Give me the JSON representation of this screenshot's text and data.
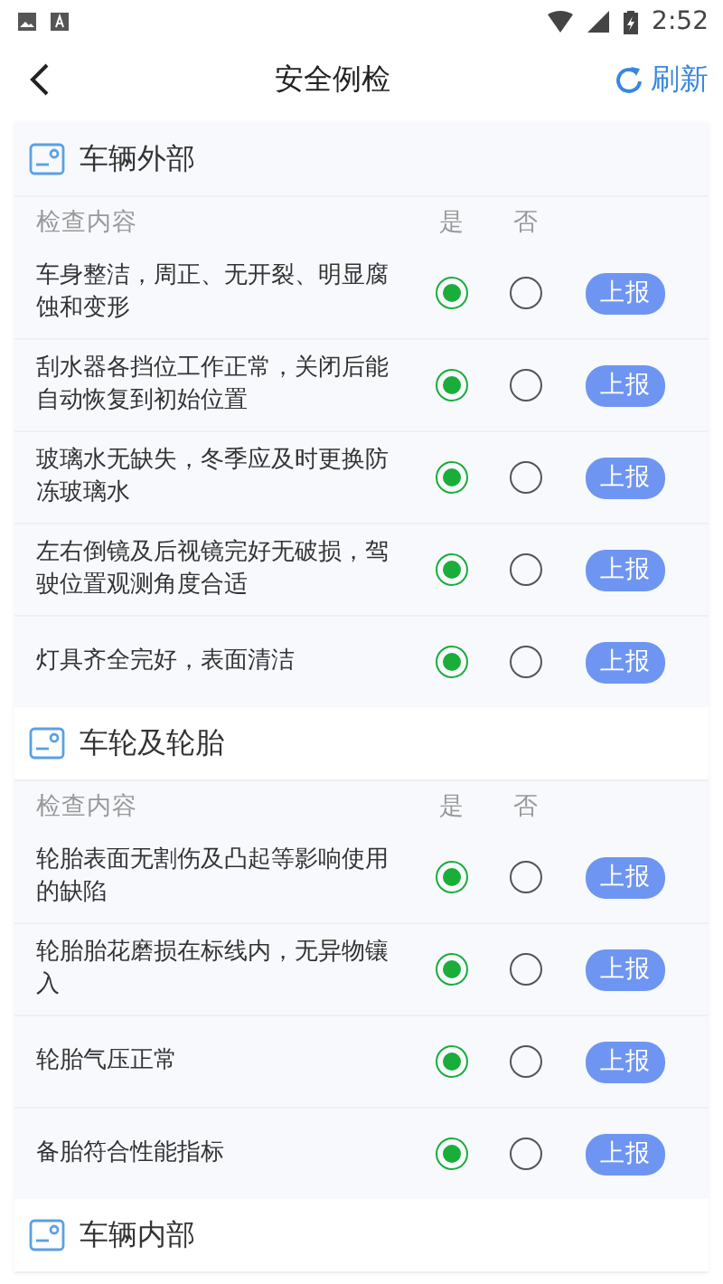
{
  "status_bar": {
    "time": "2:52"
  },
  "header": {
    "title": "安全例检",
    "refresh": "刷新"
  },
  "sections": [
    {
      "title": "车辆外部",
      "columns": {
        "content": "检查内容",
        "yes": "是",
        "no": "否"
      },
      "items": [
        {
          "text": "车身整洁，周正、无开裂、明显腐蚀和变形",
          "yes_selected": true,
          "no_selected": false,
          "report": "上报"
        },
        {
          "text": "刮水器各挡位工作正常，关闭后能自动恢复到初始位置",
          "yes_selected": true,
          "no_selected": false,
          "report": "上报"
        },
        {
          "text": "玻璃水无缺失，冬季应及时更换防冻玻璃水",
          "yes_selected": true,
          "no_selected": false,
          "report": "上报"
        },
        {
          "text": "左右倒镜及后视镜完好无破损，驾驶位置观测角度合适",
          "yes_selected": true,
          "no_selected": false,
          "report": "上报"
        },
        {
          "text": "灯具齐全完好，表面清洁",
          "yes_selected": true,
          "no_selected": false,
          "report": "上报"
        }
      ]
    },
    {
      "title": "车轮及轮胎",
      "columns": {
        "content": "检查内容",
        "yes": "是",
        "no": "否"
      },
      "items": [
        {
          "text": "轮胎表面无割伤及凸起等影响使用的缺陷",
          "yes_selected": true,
          "no_selected": false,
          "report": "上报"
        },
        {
          "text": "轮胎胎花磨损在标线内，无异物镶入",
          "yes_selected": true,
          "no_selected": false,
          "report": "上报"
        },
        {
          "text": "轮胎气压正常",
          "yes_selected": true,
          "no_selected": false,
          "report": "上报"
        },
        {
          "text": "备胎符合性能指标",
          "yes_selected": true,
          "no_selected": false,
          "report": "上报"
        }
      ]
    },
    {
      "title": "车辆内部"
    }
  ]
}
